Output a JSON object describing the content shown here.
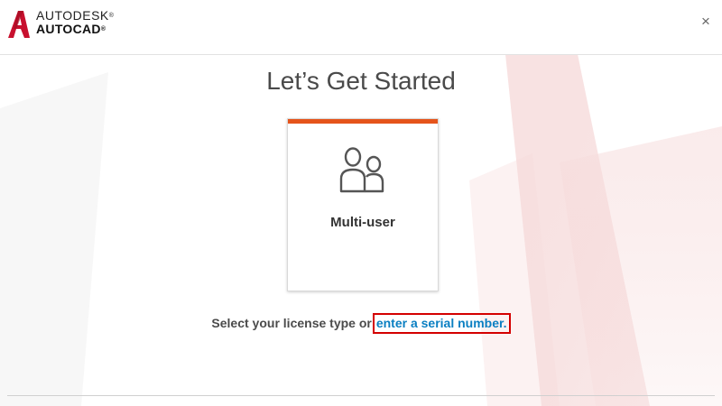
{
  "header": {
    "brand_line1": "AUTODESK",
    "brand_line2": "AUTOCAD",
    "registered_mark": "®",
    "close_icon": "×"
  },
  "main": {
    "title": "Let’s Get Started",
    "card": {
      "label": "Multi-user",
      "icon": "multi-user-icon"
    },
    "prompt_text": "Select your license type or",
    "serial_link": "enter a serial number."
  },
  "colors": {
    "accent_bar": "#e5541b",
    "link": "#0a7fc2",
    "highlight_box": "#d40000",
    "logo": "#c8102e"
  }
}
